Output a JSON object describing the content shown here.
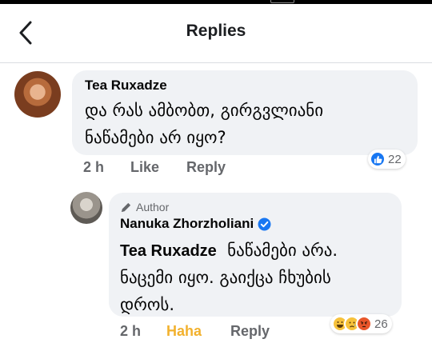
{
  "header": {
    "title": "Replies"
  },
  "comments": [
    {
      "author": "Tea Ruxadze",
      "text_lines": [
        "და რას ამბობთ, გირგვლიანი",
        "ნაწამები არ იყო?"
      ],
      "time": "2 h",
      "actions": [
        "Like",
        "Reply"
      ],
      "reactions": {
        "icons": [
          "like-icon"
        ],
        "count": "22"
      }
    },
    {
      "badge": "Author",
      "author": "Nanuka Zhorzholiani",
      "verified": true,
      "tag": "Tea Ruxadze",
      "text_lines": [
        "ნაწამები არა.",
        "ნაცემი იყო. გაიქცა ჩხუბის",
        "დროს."
      ],
      "time": "2 h",
      "actions": [
        "Haha",
        "Reply"
      ],
      "reactions": {
        "icons": [
          "haha-icon",
          "sad-icon",
          "angry-icon"
        ],
        "count": "26"
      }
    }
  ],
  "colors": {
    "like_blue": "#1877f2",
    "haha_yellow": "#f2b12e",
    "bubble_bg": "#f0f2f5",
    "meta_gray": "#65676b"
  }
}
